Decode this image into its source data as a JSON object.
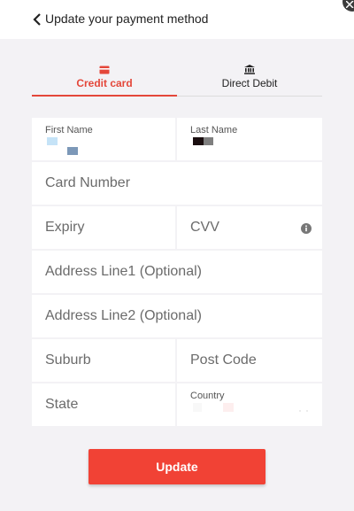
{
  "header": {
    "title": "Update your payment method"
  },
  "tabs": [
    {
      "label": "Credit card",
      "icon": "credit-card-icon",
      "active": true
    },
    {
      "label": "Direct Debit",
      "icon": "bank-icon",
      "active": false
    }
  ],
  "form": {
    "first_name_label": "First Name",
    "last_name_label": "Last Name",
    "card_number_placeholder": "Card Number",
    "expiry_placeholder": "Expiry",
    "cvv_placeholder": "CVV",
    "address1_placeholder": "Address Line1 (Optional)",
    "address2_placeholder": "Address Line2 (Optional)",
    "suburb_placeholder": "Suburb",
    "postcode_placeholder": "Post Code",
    "state_placeholder": "State",
    "country_label": "Country"
  },
  "actions": {
    "update_label": "Update"
  },
  "colors": {
    "accent": "#e4473a",
    "button": "#f14235",
    "background": "#f3f2f5"
  }
}
